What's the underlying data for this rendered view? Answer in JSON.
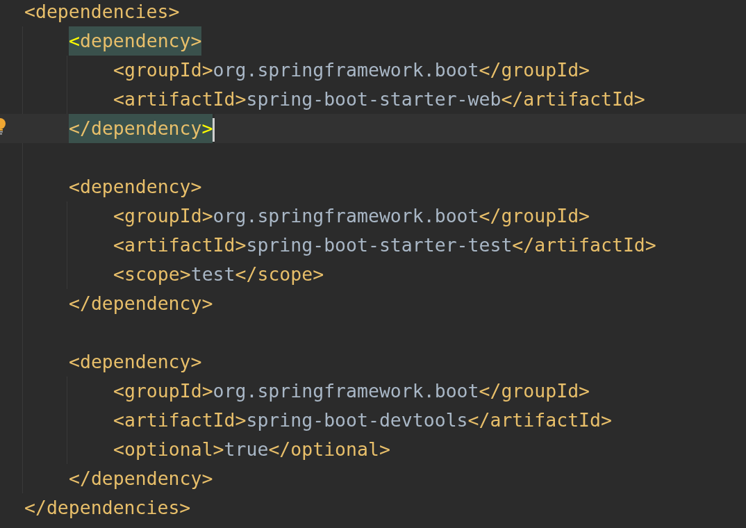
{
  "editor": {
    "root": {
      "kind": "element",
      "open": "<dependencies>",
      "close": "</dependencies>",
      "matched": false,
      "caret_on_close": false,
      "children": [
        {
          "kind": "element",
          "open": "<dependency>",
          "close": "</dependency>",
          "matched": true,
          "caret_on_close": true,
          "children": [
            {
              "kind": "leaf",
              "text": "<groupId>org.springframework.boot</groupId>"
            },
            {
              "kind": "leaf",
              "text": "<artifactId>spring-boot-starter-web</artifactId>"
            }
          ]
        },
        {
          "kind": "element",
          "open": "<dependency>",
          "close": "</dependency>",
          "matched": false,
          "caret_on_close": false,
          "children": [
            {
              "kind": "leaf",
              "text": "<groupId>org.springframework.boot</groupId>"
            },
            {
              "kind": "leaf",
              "text": "<artifactId>spring-boot-starter-test</artifactId>"
            },
            {
              "kind": "leaf",
              "text": "<scope>test</scope>"
            }
          ]
        },
        {
          "kind": "element",
          "open": "<dependency>",
          "close": "</dependency>",
          "matched": false,
          "caret_on_close": false,
          "children": [
            {
              "kind": "leaf",
              "text": "<groupId>org.springframework.boot</groupId>"
            },
            {
              "kind": "leaf",
              "text": "<artifactId>spring-boot-devtools</artifactId>"
            },
            {
              "kind": "leaf",
              "text": "<optional>true</optional>"
            }
          ]
        }
      ]
    }
  }
}
